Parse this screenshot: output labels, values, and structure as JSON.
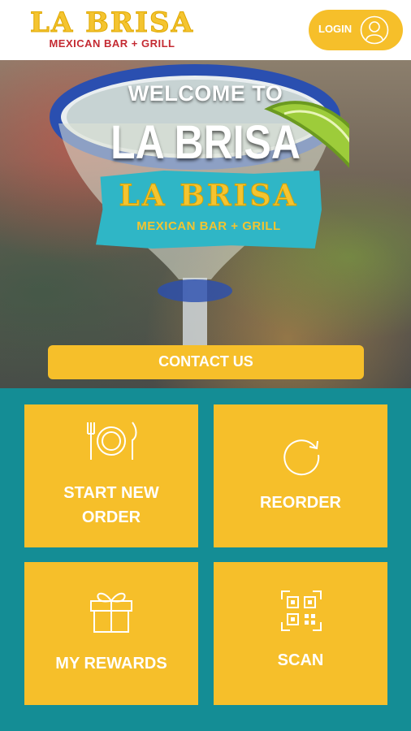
{
  "header": {
    "brand_title": "LA BRISA",
    "brand_subtitle": "MEXICAN BAR + GRILL",
    "login_label": "LOGIN"
  },
  "hero": {
    "welcome_line": "WELCOME TO",
    "welcome_name": "LA BRISA",
    "badge_title": "LA BRISA",
    "badge_subtitle": "MEXICAN BAR + GRILL",
    "contact_label": "CONTACT US"
  },
  "tiles": [
    {
      "label_line1": "START NEW",
      "label_line2": "ORDER",
      "icon": "plate-utensils-icon"
    },
    {
      "label_line1": "REORDER",
      "label_line2": "",
      "icon": "refresh-icon"
    },
    {
      "label_line1": "MY REWARDS",
      "label_line2": "",
      "icon": "gift-icon"
    },
    {
      "label_line1": "SCAN",
      "label_line2": "",
      "icon": "qr-code-icon"
    }
  ],
  "colors": {
    "accent_yellow": "#f6bf2a",
    "brand_teal": "#148d95",
    "badge_teal": "#2fb6c6",
    "brand_red": "#c42a32"
  }
}
